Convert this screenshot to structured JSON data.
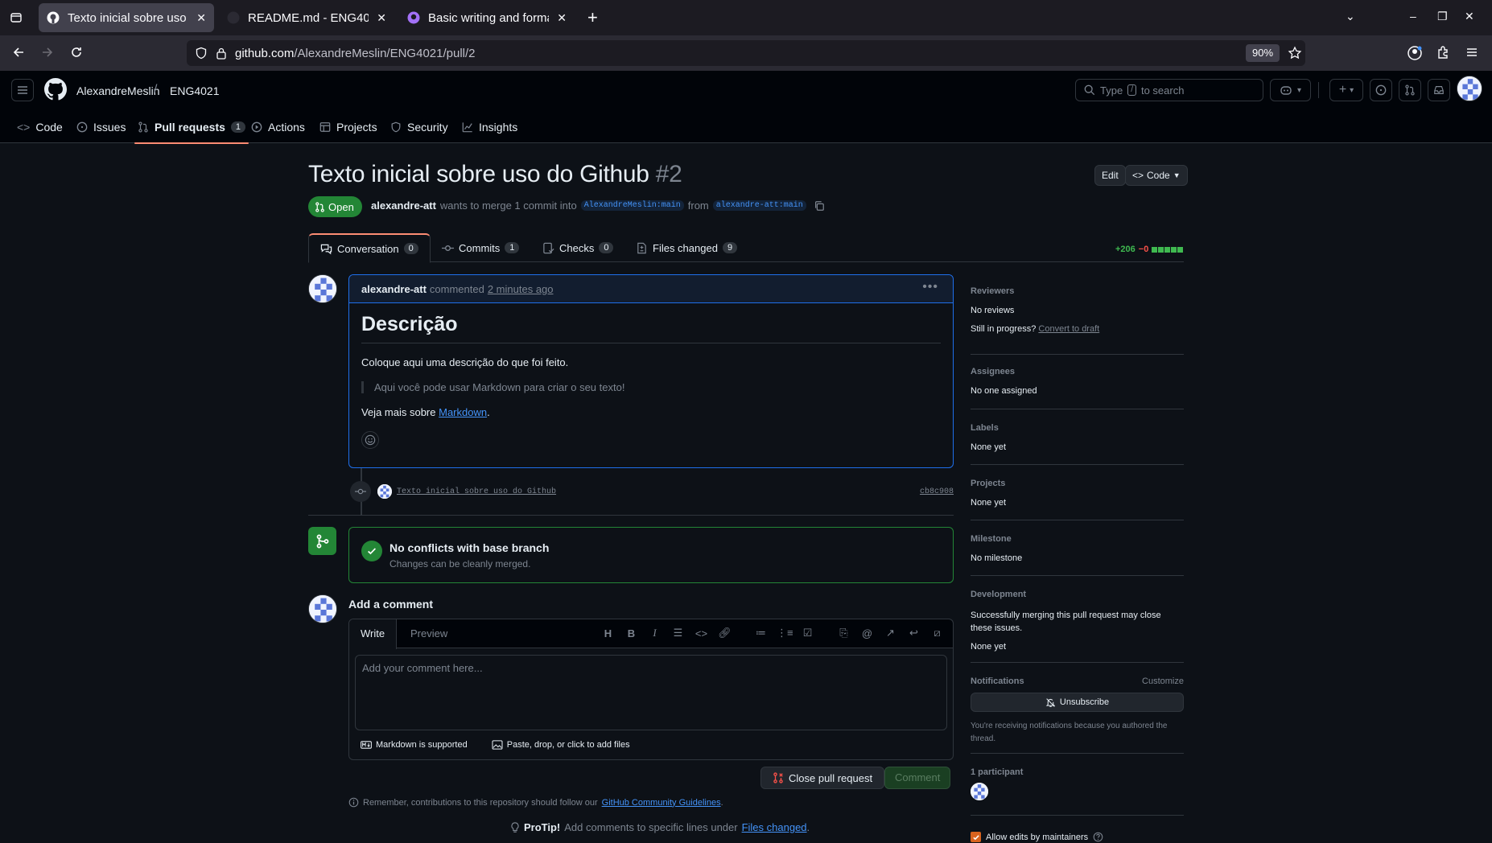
{
  "browser": {
    "tabs": [
      {
        "title": "Texto inicial sobre uso do Github"
      },
      {
        "title": "README.md - ENG4021 [..."
      },
      {
        "title": "Basic writing and formatting"
      }
    ],
    "url_host": "github.com",
    "url_path": "/AlexandreMeslin/ENG4021/pull/2",
    "zoom": "90%"
  },
  "header": {
    "owner": "AlexandreMeslin",
    "separator": "/",
    "repo": "ENG4021",
    "search_prefix": "Type",
    "search_key": "/",
    "search_suffix": "to search",
    "nav": [
      {
        "label": "Code"
      },
      {
        "label": "Issues"
      },
      {
        "label": "Pull requests",
        "count": "1"
      },
      {
        "label": "Actions"
      },
      {
        "label": "Projects"
      },
      {
        "label": "Security"
      },
      {
        "label": "Insights"
      }
    ]
  },
  "pr": {
    "title": "Texto inicial sobre uso do Github",
    "number": "#2",
    "edit_label": "Edit",
    "code_label": "Code",
    "state": "Open",
    "author": "alexandre-att",
    "merge_text": "wants to merge 1 commit into",
    "base_branch": "AlexandreMeslin:main",
    "from_text": "from",
    "head_branch": "alexandre-att:main",
    "tabs": [
      {
        "label": "Conversation",
        "count": "0"
      },
      {
        "label": "Commits",
        "count": "1"
      },
      {
        "label": "Checks",
        "count": "0"
      },
      {
        "label": "Files changed",
        "count": "9"
      }
    ],
    "additions": "+206",
    "deletions": "−0"
  },
  "comment": {
    "author": "alexandre-att",
    "action": "commented",
    "when": "2 minutes ago",
    "heading": "Descrição",
    "paragraph": "Coloque aqui uma descrição do que foi feito.",
    "quote": "Aqui você pode usar Markdown para criar o seu texto!",
    "see_more": "Veja mais sobre",
    "link": "Markdown",
    "period": "."
  },
  "commit": {
    "message": "Texto inicial sobre uso do Github",
    "sha": "cb8c908"
  },
  "merge": {
    "title": "No conflicts with base branch",
    "subtitle": "Changes can be cleanly merged."
  },
  "composer": {
    "label": "Add a comment",
    "write_tab": "Write",
    "preview_tab": "Preview",
    "placeholder": "Add your comment here...",
    "markdown_note": "Markdown is supported",
    "attach_note": "Paste, drop, or click to add files",
    "close_button": "Close pull request",
    "comment_button": "Comment"
  },
  "footer": {
    "guidelines_text": "Remember, contributions to this repository should follow our",
    "guidelines_link": "GitHub Community Guidelines",
    "guidelines_end": ".",
    "protip_label": "ProTip!",
    "protip_text": "Add comments to specific lines under",
    "protip_link": "Files changed",
    "protip_end": "."
  },
  "sidebar": {
    "reviewers_title": "Reviewers",
    "reviewers_value": "No reviews",
    "still_in_progress": "Still in progress?",
    "convert_to_draft": "Convert to draft",
    "assignees_title": "Assignees",
    "assignees_value": "No one assigned",
    "labels_title": "Labels",
    "labels_value": "None yet",
    "projects_title": "Projects",
    "projects_value": "None yet",
    "milestone_title": "Milestone",
    "milestone_value": "No milestone",
    "development_title": "Development",
    "development_text": "Successfully merging this pull request may close these issues.",
    "development_value": "None yet",
    "notifications_title": "Notifications",
    "customize": "Customize",
    "unsubscribe": "Unsubscribe",
    "notif_reason": "You're receiving notifications because you authored the thread.",
    "participants": "1 participant",
    "allow_edits": "Allow edits by maintainers"
  },
  "colors": {
    "accent": "#238636",
    "link": "#4493f8",
    "underline_tab": "#fd8c73"
  }
}
